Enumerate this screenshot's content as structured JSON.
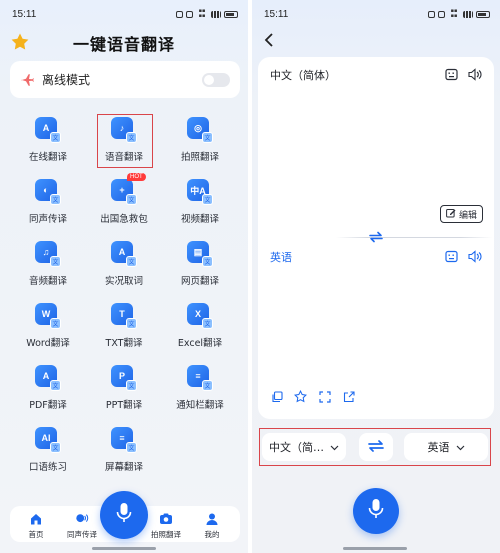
{
  "status_left": {
    "time": "15:11"
  },
  "status_right": {
    "time": "15:11"
  },
  "home": {
    "title": "一键语音翻译",
    "offline_mode_label": "离线模式",
    "offline_mode_enabled": false,
    "features": [
      {
        "label": "在线翻译",
        "icon": "online-translate-icon",
        "glyph": "A"
      },
      {
        "label": "语音翻译",
        "icon": "voice-translate-icon",
        "glyph": "♪"
      },
      {
        "label": "拍照翻译",
        "icon": "photo-translate-icon",
        "glyph": "◎"
      },
      {
        "label": "同声传译",
        "icon": "simultaneous-interpret-icon",
        "glyph": "◐"
      },
      {
        "label": "出国急救包",
        "icon": "first-aid-kit-icon",
        "glyph": "+",
        "badge": "HOT"
      },
      {
        "label": "视频翻译",
        "icon": "video-translate-icon",
        "glyph": "中A"
      },
      {
        "label": "音频翻译",
        "icon": "audio-translate-icon",
        "glyph": "♫"
      },
      {
        "label": "实况取词",
        "icon": "live-capture-icon",
        "glyph": "A"
      },
      {
        "label": "网页翻译",
        "icon": "webpage-translate-icon",
        "glyph": "▤"
      },
      {
        "label": "Word翻译",
        "icon": "word-translate-icon",
        "glyph": "W"
      },
      {
        "label": "TXT翻译",
        "icon": "txt-translate-icon",
        "glyph": "T"
      },
      {
        "label": "Excel翻译",
        "icon": "excel-translate-icon",
        "glyph": "X"
      },
      {
        "label": "PDF翻译",
        "icon": "pdf-translate-icon",
        "glyph": "A"
      },
      {
        "label": "PPT翻译",
        "icon": "ppt-translate-icon",
        "glyph": "P"
      },
      {
        "label": "通知栏翻译",
        "icon": "notification-translate-icon",
        "glyph": "≡"
      },
      {
        "label": "口语练习",
        "icon": "speaking-practice-icon",
        "glyph": "AI"
      },
      {
        "label": "屏幕翻译",
        "icon": "screen-translate-icon",
        "glyph": "≡"
      }
    ],
    "nav": [
      {
        "label": "首页",
        "icon": "home-icon"
      },
      {
        "label": "同声传译",
        "icon": "interpret-icon"
      },
      {
        "label": "拍照翻译",
        "icon": "camera-icon"
      },
      {
        "label": "我的",
        "icon": "profile-icon"
      }
    ]
  },
  "translate": {
    "source_language": "中文（简体）",
    "target_language": "英语",
    "edit_label": "编辑",
    "selector_source": "中文（简…",
    "selector_target": "英语"
  },
  "colors": {
    "accent": "#1d69ee",
    "highlight_box": "#d9454a",
    "star": "#f5b21b",
    "hot_badge": "#ff3b3b"
  }
}
